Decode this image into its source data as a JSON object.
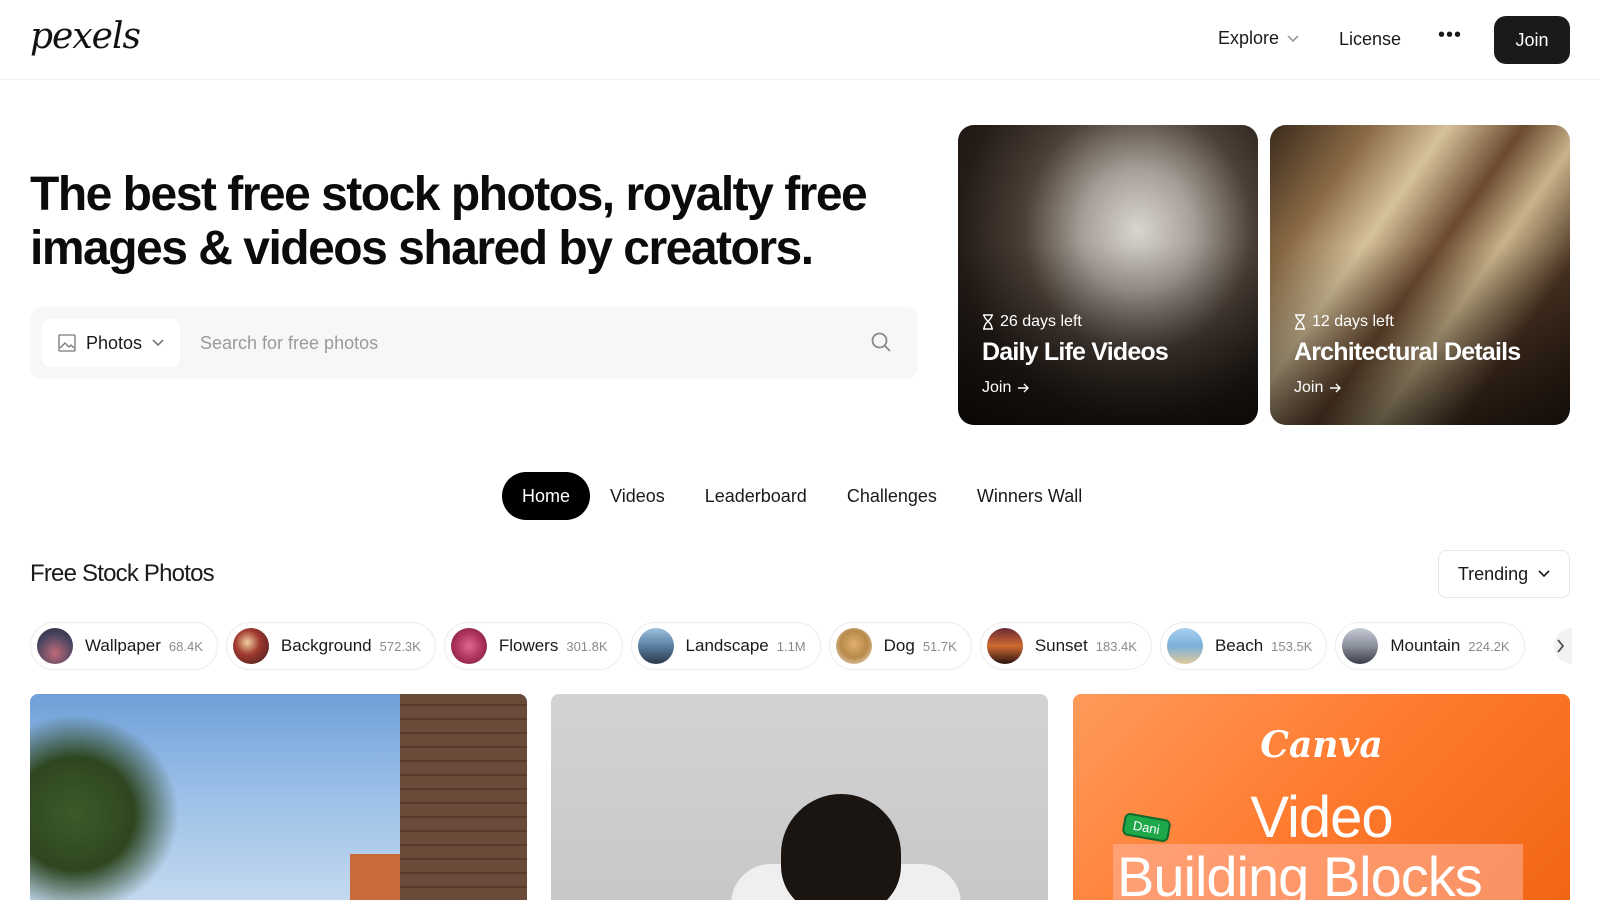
{
  "header": {
    "logo": "pexels",
    "explore_label": "Explore",
    "license_label": "License",
    "more_label": "•••",
    "join_label": "Join"
  },
  "hero": {
    "title": "The best free stock photos, royalty free images & videos shared by creators.",
    "search": {
      "type_label": "Photos",
      "placeholder": "Search for free photos",
      "value": ""
    }
  },
  "challenges": [
    {
      "days_left": "26 days left",
      "title": "Daily Life Videos",
      "join_label": "Join"
    },
    {
      "days_left": "12 days left",
      "title": "Architectural Details",
      "join_label": "Join"
    }
  ],
  "tabs": [
    {
      "label": "Home",
      "active": true
    },
    {
      "label": "Videos",
      "active": false
    },
    {
      "label": "Leaderboard",
      "active": false
    },
    {
      "label": "Challenges",
      "active": false
    },
    {
      "label": "Winners Wall",
      "active": false
    }
  ],
  "section": {
    "title": "Free Stock Photos",
    "sort_label": "Trending"
  },
  "chips": [
    {
      "label": "Wallpaper",
      "count": "68.4K",
      "thumb_color": "#4a4560"
    },
    {
      "label": "Background",
      "count": "572.3K",
      "thumb_color": "#7a3a32"
    },
    {
      "label": "Flowers",
      "count": "301.8K",
      "thumb_color": "#b0345e"
    },
    {
      "label": "Landscape",
      "count": "1.1M",
      "thumb_color": "#5a7fa0"
    },
    {
      "label": "Dog",
      "count": "51.7K",
      "thumb_color": "#b88a4a"
    },
    {
      "label": "Sunset",
      "count": "183.4K",
      "thumb_color": "#d06a30"
    },
    {
      "label": "Beach",
      "count": "153.5K",
      "thumb_color": "#7ab0d8"
    },
    {
      "label": "Mountain",
      "count": "224.2K",
      "thumb_color": "#8a8f9c"
    }
  ],
  "photos": {
    "ad": {
      "brand": "Canva",
      "line1": "Video",
      "line2": "Building Blocks",
      "tag": "Dani"
    }
  },
  "colors": {
    "primary_dark": "#1a1a1a",
    "accent_ad": "#ff7a2e"
  }
}
